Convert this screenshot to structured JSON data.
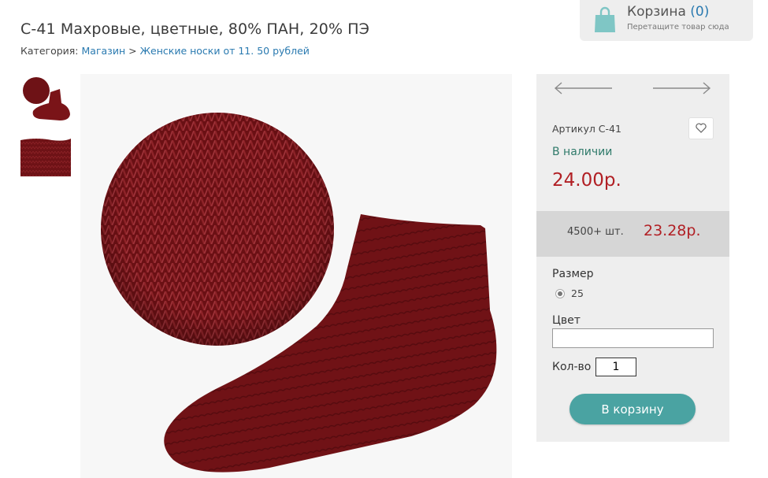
{
  "product": {
    "title": "С-41 Махровые, цветные, 80% ПАН, 20% ПЭ"
  },
  "breadcrumb": {
    "prefix": "Категория:",
    "shop": "Магазин",
    "separator": ">",
    "category": "Женские носки от 11. 50 рублей"
  },
  "cart": {
    "title": "Корзина",
    "count": "(0)",
    "hint": "Перетащите товар сюда",
    "icon": "shopping-bag-icon"
  },
  "panel": {
    "sku": "Артикул С-41",
    "stock": "В наличии",
    "price": "24.00р.",
    "bulk_qty": "4500+ шт.",
    "bulk_price": "23.28р.",
    "size_label": "Размер",
    "size_option": "25",
    "color_label": "Цвет",
    "color_value": "",
    "qty_label": "Кол-во",
    "qty_value": "1",
    "add_to_cart": "В корзину"
  },
  "colors": {
    "sock": "#7a1418",
    "accent": "#4aa3a2",
    "price": "#b11f24",
    "link": "#2a7ab0",
    "stock": "#2f7a6a"
  },
  "icons": [
    "shopping-bag-icon",
    "arrow-left-icon",
    "arrow-right-icon",
    "heart-icon",
    "radio-selected-icon"
  ]
}
